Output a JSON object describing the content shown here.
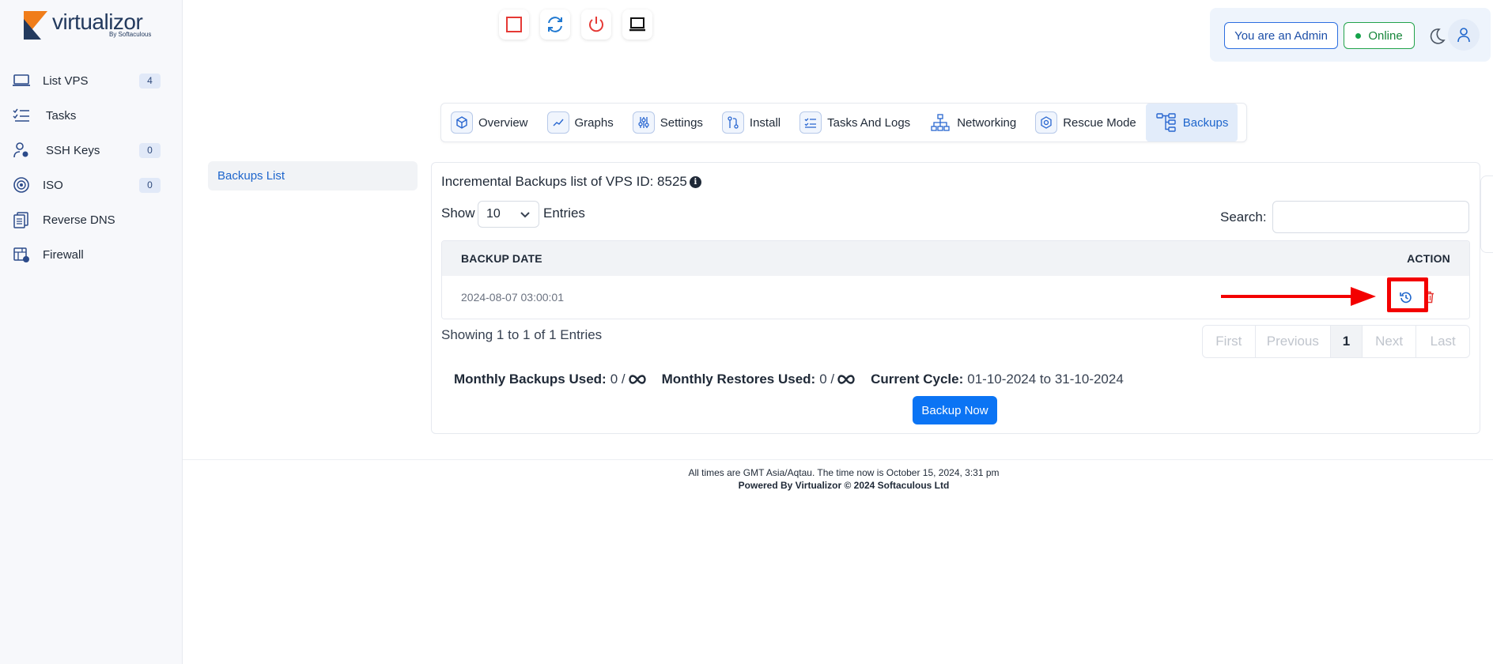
{
  "app": {
    "logo_text": "virtualizor",
    "logo_sub": "By Softaculous"
  },
  "sidebar": {
    "items": [
      {
        "label": "List VPS",
        "badge": "4",
        "icon": "laptop-icon"
      },
      {
        "label": "Tasks",
        "badge": "",
        "icon": "tasks-icon"
      },
      {
        "label": "SSH Keys",
        "badge": "0",
        "icon": "ssh-key-user-icon"
      },
      {
        "label": "ISO",
        "badge": "0",
        "icon": "disc-icon"
      },
      {
        "label": "Reverse DNS",
        "badge": "",
        "icon": "dns-icon"
      },
      {
        "label": "Firewall",
        "badge": "",
        "icon": "firewall-icon"
      }
    ]
  },
  "header": {
    "admin_label": "You are an Admin",
    "status_label": "Online",
    "colors": {
      "accent": "#0b74f4",
      "online": "#16a34a",
      "stop": "#e53935"
    }
  },
  "tabs": [
    {
      "label": "Overview",
      "icon": "cube-icon"
    },
    {
      "label": "Graphs",
      "icon": "graph-icon"
    },
    {
      "label": "Settings",
      "icon": "sliders-icon"
    },
    {
      "label": "Install",
      "icon": "install-icon"
    },
    {
      "label": "Tasks And Logs",
      "icon": "checklist-icon"
    },
    {
      "label": "Networking",
      "icon": "network-icon"
    },
    {
      "label": "Rescue Mode",
      "icon": "rescue-box-icon"
    },
    {
      "label": "Backups",
      "icon": "backup-tree-icon"
    }
  ],
  "active_tab": "Backups",
  "subnav": {
    "label": "Backups List"
  },
  "backups": {
    "title": "Incremental Backups list of VPS ID: 8525",
    "show_label": "Show",
    "page_size": "10",
    "entries_label": "Entries",
    "search_label": "Search:",
    "search_value": "",
    "columns": [
      "BACKUP DATE",
      "ACTION"
    ],
    "rows": [
      {
        "date": "2024-08-07 03:00:01"
      }
    ],
    "showing": "Showing 1 to 1 of 1 Entries",
    "pager": [
      "First",
      "Previous",
      "1",
      "Next",
      "Last"
    ],
    "current_page": "1",
    "monthly_backups_label": "Monthly Backups Used:",
    "monthly_backups_value": "0 /",
    "monthly_restores_label": "Monthly Restores Used:",
    "monthly_restores_value": "0 /",
    "cycle_label": "Current Cycle:",
    "cycle_value": "01-10-2024 to 31-10-2024",
    "backup_now_label": "Backup Now"
  },
  "footer": {
    "line1": "All times are GMT Asia/Aqtau. The time now is October 15, 2024, 3:31 pm",
    "line2": "Powered By Virtualizor © 2024 Softaculous Ltd"
  }
}
